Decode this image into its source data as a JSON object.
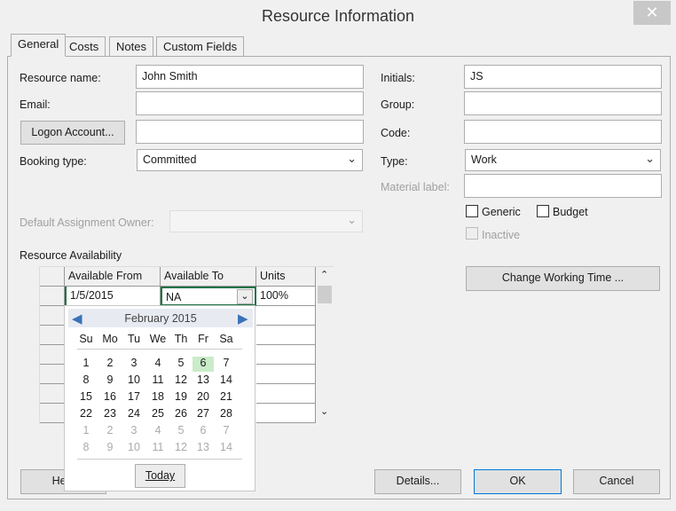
{
  "window": {
    "title": "Resource Information",
    "close_icon": "close-icon"
  },
  "tabs": [
    {
      "label": "General",
      "selected": true
    },
    {
      "label": "Costs"
    },
    {
      "label": "Notes"
    },
    {
      "label": "Custom Fields"
    }
  ],
  "general": {
    "resource_name_label": "Resource name:",
    "resource_name_value": "John Smith",
    "email_label": "Email:",
    "email_value": "",
    "logon_button": "Logon Account...",
    "logon_value": "",
    "booking_type_label": "Booking type:",
    "booking_type_value": "Committed",
    "default_owner_label": "Default Assignment Owner:",
    "default_owner_value": "",
    "initials_label": "Initials:",
    "initials_value": "JS",
    "group_label": "Group:",
    "group_value": "",
    "code_label": "Code:",
    "code_value": "",
    "type_label": "Type:",
    "type_value": "Work",
    "material_label": "Material label:",
    "material_value": "",
    "generic_label": "Generic",
    "generic_checked": false,
    "budget_label": "Budget",
    "budget_checked": false,
    "inactive_label": "Inactive",
    "inactive_checked": false,
    "change_working_time": "Change Working Time ..."
  },
  "availability": {
    "label": "Resource Availability",
    "columns": [
      "Available From",
      "Available To",
      "Units"
    ],
    "rows": [
      {
        "from": "1/5/2015",
        "to": "NA",
        "units": "100%"
      }
    ]
  },
  "calendar": {
    "month": "February 2015",
    "weekdays": [
      "Su",
      "Mo",
      "Tu",
      "We",
      "Th",
      "Fr",
      "Sa"
    ],
    "weeks": [
      [
        "1",
        "2",
        "3",
        "4",
        "5",
        "6",
        "7"
      ],
      [
        "8",
        "9",
        "10",
        "11",
        "12",
        "13",
        "14"
      ],
      [
        "15",
        "16",
        "17",
        "18",
        "19",
        "20",
        "21"
      ],
      [
        "22",
        "23",
        "24",
        "25",
        "26",
        "27",
        "28"
      ],
      [
        "1",
        "2",
        "3",
        "4",
        "5",
        "6",
        "7"
      ],
      [
        "8",
        "9",
        "10",
        "11",
        "12",
        "13",
        "14"
      ]
    ],
    "highlighted": "6",
    "highlight_color": "#c9ecc9",
    "today_button": "Today"
  },
  "footer": {
    "help": "Help",
    "details": "Details...",
    "ok": "OK",
    "cancel": "Cancel"
  }
}
